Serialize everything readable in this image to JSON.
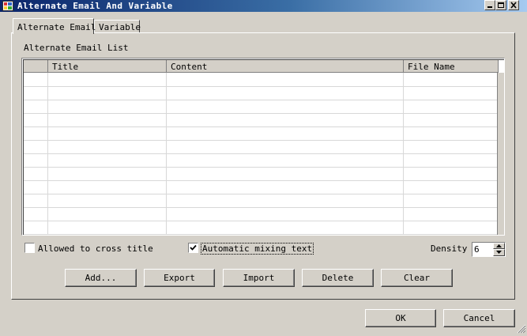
{
  "window": {
    "title": "Alternate Email And Variable",
    "icon": "app-icon",
    "controls": [
      "minimize-icon",
      "maximize-icon",
      "close-icon"
    ]
  },
  "tabs": [
    {
      "label": "Alternate Email",
      "selected": true
    },
    {
      "label": "Variable",
      "selected": false
    }
  ],
  "group_label": "Alternate Email List",
  "table": {
    "columns": [
      "",
      "Title",
      "Content",
      "File Name"
    ],
    "rows": []
  },
  "options": {
    "cross_title_label": "Allowed to cross title",
    "cross_title_checked": false,
    "mixing_label": "Automatic mixing text",
    "mixing_checked": true,
    "density_label": "Density",
    "density_value": "6"
  },
  "buttons": {
    "add": "Add...",
    "export": "Export",
    "import": "Import",
    "delete": "Delete",
    "clear": "Clear",
    "ok": "OK",
    "cancel": "Cancel"
  }
}
